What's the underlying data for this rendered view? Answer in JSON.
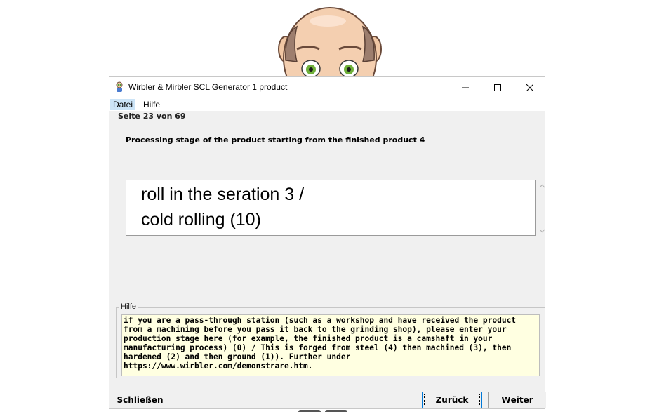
{
  "window": {
    "title": "Wirbler & Mirbler SCL Generator 1 product"
  },
  "menu": {
    "items": [
      {
        "label": "Datei"
      },
      {
        "label": "Hilfe"
      }
    ]
  },
  "page": {
    "indicator": "Seite 23 von 69",
    "question": "Processing stage of the product starting from the finished product 4",
    "answer_lines": [
      "roll in the seration 3 /",
      "cold rolling  (10)"
    ]
  },
  "help": {
    "legend": "Hilfe",
    "text": "if you are a pass-through station (such as a workshop and have received the product from a machining before you pass it back to the grinding shop), please enter your production stage here (for example, the finished product is a camshaft in your manufacturing process) (0) / This is forged from steel (4) then machined (3), then hardened (2) and then ground (1)). Further under https://www.wirbler.com/demonstrare.htm."
  },
  "buttons": {
    "close_first": "S",
    "close_rest": "chließen",
    "back_first": "Z",
    "back_rest": "urück",
    "next_first": "W",
    "next_rest": "eiter"
  },
  "icons": {
    "app": "app-person-icon",
    "minimize": "minimize-icon",
    "maximize": "maximize-icon",
    "close": "close-icon",
    "scroll_up": "chevron-up-icon",
    "scroll_down": "chevron-down-icon"
  }
}
